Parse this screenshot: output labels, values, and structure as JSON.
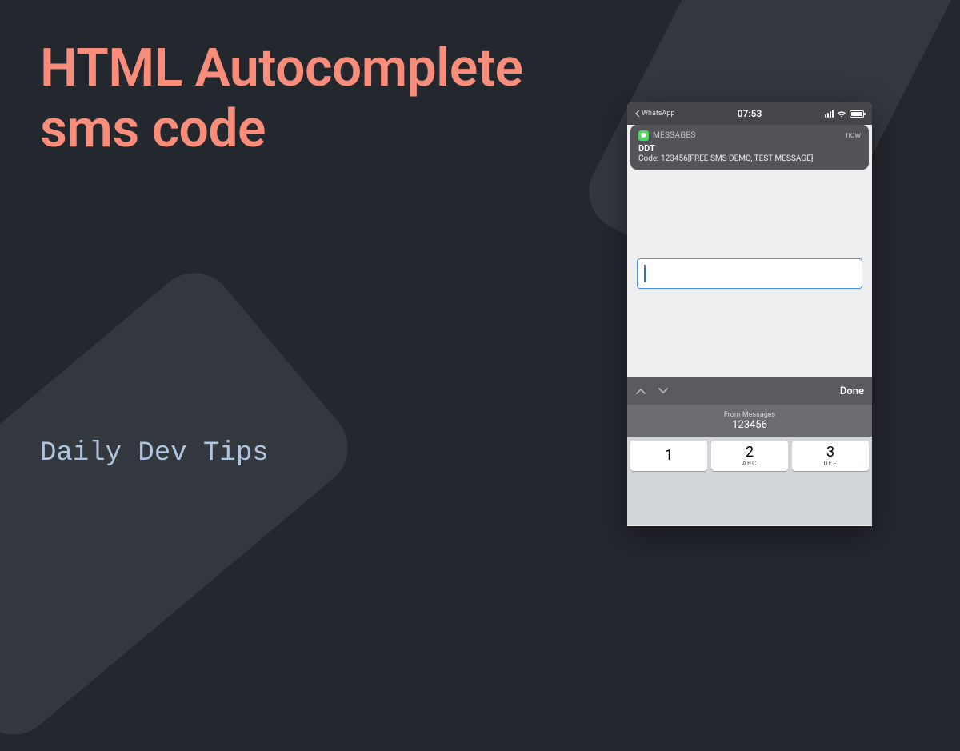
{
  "headline": {
    "line1": "HTML Autocomplete",
    "line2": "sms code"
  },
  "subtitle": "Daily Dev Tips",
  "phone": {
    "status": {
      "back_app": "WhatsApp",
      "time": "07:53"
    },
    "notification": {
      "app_name": "MESSAGES",
      "timestamp": "now",
      "title": "DDT",
      "body": "Code: 123456[FREE SMS DEMO, TEST MESSAGE]"
    },
    "keyboard": {
      "done_label": "Done",
      "autofill": {
        "label": "From Messages",
        "code": "123456"
      },
      "keys": [
        {
          "num": "1",
          "letters": ""
        },
        {
          "num": "2",
          "letters": "ABC"
        },
        {
          "num": "3",
          "letters": "DEF"
        }
      ]
    }
  }
}
